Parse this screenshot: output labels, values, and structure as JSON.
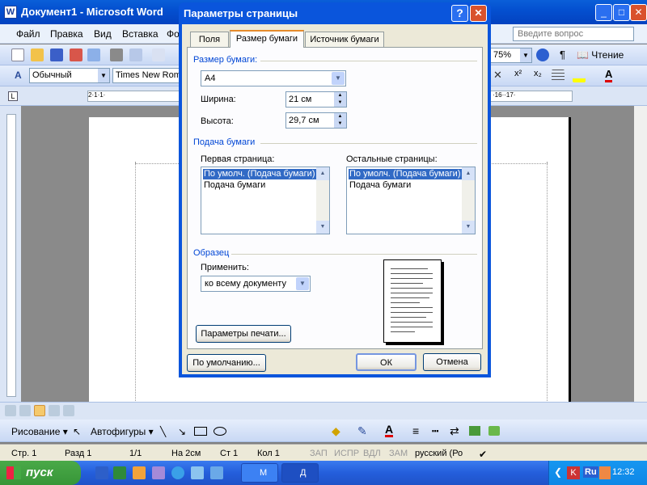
{
  "word": {
    "title": "Документ1 - Microsoft Word",
    "menu": [
      "Файл",
      "Правка",
      "Вид",
      "Вставка",
      "Фо"
    ],
    "help_placeholder": "Введите вопрос",
    "zoom": "75%",
    "reading": "Чтение",
    "style": "Обычный",
    "font": "Times New Roma",
    "ruler_left": "2·1·1·",
    "ruler_right": "·16··17·",
    "draw_label": "Рисование ▾",
    "autoshapes": "Автофигуры ▾",
    "status": {
      "page": "Стр. 1",
      "section": "Разд 1",
      "pages": "1/1",
      "at": "На 2см",
      "line": "Ст 1",
      "col": "Кол 1",
      "rec": "ЗАП",
      "trk": "ИСПР",
      "ext": "ВДЛ",
      "ovr": "ЗАМ",
      "lang": "русский (Ро"
    }
  },
  "taskbar": {
    "start": "пуск",
    "tasks": [
      "М",
      "Д"
    ],
    "lang": "Ru",
    "time": "12:32"
  },
  "dialog": {
    "title": "Параметры страницы",
    "help_btn": "?",
    "close_btn": "✕",
    "tabs": [
      "Поля",
      "Размер бумаги",
      "Источник бумаги"
    ],
    "paper_size_group": "Размер бумаги:",
    "paper_size": "A4",
    "width_label": "Ширина:",
    "width_value": "21 см",
    "height_label": "Высота:",
    "height_value": "29,7 см",
    "paper_source_group": "Подача бумаги",
    "first_page_label": "Первая страница:",
    "other_pages_label": "Остальные страницы:",
    "first_page_items": [
      "По умолч. (Подача бумаги)",
      "Подача бумаги"
    ],
    "other_pages_items": [
      "По умолч. (Подача бумаги)",
      "Подача бумаги"
    ],
    "sample_group": "Образец",
    "apply_label": "Применить:",
    "apply_value": "ко всему документу",
    "print_options": "Параметры печати...",
    "default_btn": "По умолчанию...",
    "ok_btn": "ОК",
    "cancel_btn": "Отмена"
  }
}
